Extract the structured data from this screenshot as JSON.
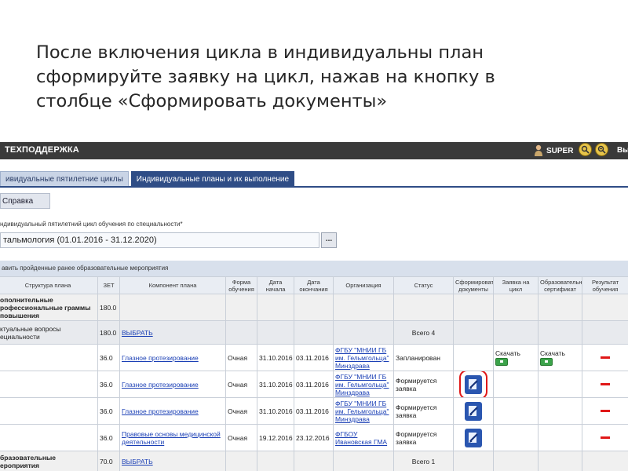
{
  "slide": {
    "title_lines": [
      "После включения цикла в индивидуальны план",
      "сформируйте заявку на цикл, нажав на кнопку в",
      "столбце «Сформировать документы»"
    ]
  },
  "app": {
    "brand": "ТЕХПОДДЕРЖКА",
    "user": "SUPER",
    "exit_label": "Вы",
    "tabs": [
      {
        "label": "ивидуальные пятилетние циклы",
        "active": false
      },
      {
        "label": "Индивидуальные планы и их выполнение",
        "active": true
      }
    ],
    "help_label": "Справка",
    "cycle_field_label": "ндивидуальный пятилетний цикл обучения по специальности*",
    "cycle_value": "тальмология (01.01.2016 - 31.12.2020)",
    "cycle_button": "...",
    "section_header": "авить пройденные ранее образовательные мероприятия",
    "table": {
      "headers": [
        "Структура плана",
        "ЗЕТ",
        "Компонент плана",
        "Форма обучения",
        "Дата начала",
        "Дата окончания",
        "Организация",
        "Статус",
        "Сформировать документы",
        "Заявка на цикл",
        "Образовательный сертификат",
        "Результат обучения"
      ],
      "group1": {
        "name": "ополнительные рофессиональные граммы повышения",
        "zet": "180.0"
      },
      "sub1": {
        "name": "ктуальные вопросы ециальности",
        "zet": "180.0",
        "link": "ВЫБРАТЬ",
        "total": "Всего 4"
      },
      "rows": [
        {
          "zet": "36.0",
          "component": "Глазное протезирование",
          "form": "Очная",
          "start": "31.10.2016",
          "end": "03.11.2016",
          "org": "ФГБУ \"МНИИ ГБ им. Гельмгольца\" Минздрава",
          "status": "Запланирован",
          "application": "Скачать",
          "certificate": "Скачать"
        },
        {
          "zet": "36.0",
          "component": "Глазное протезирование",
          "form": "Очная",
          "start": "31.10.2016",
          "end": "03.11.2016",
          "org": "ФГБУ \"МНИИ ГБ им. Гельмгольца\" Минздрава",
          "status": "Формируется заявка"
        },
        {
          "zet": "36.0",
          "component": "Глазное протезирование",
          "form": "Очная",
          "start": "31.10.2016",
          "end": "03.11.2016",
          "org": "ФГБУ \"МНИИ ГБ им. Гельмгольца\" Минздрава",
          "status": "Формируется заявка"
        },
        {
          "zet": "36.0",
          "component": "Правовые основы медицинской деятельности",
          "form": "Очная",
          "start": "19.12.2016",
          "end": "23.12.2016",
          "org": "ФГБОУ Ивановская ГМА",
          "status": "Формируется заявка"
        }
      ],
      "group2": {
        "name": "бразовательные ероприятия",
        "zet": "70.0",
        "link": "ВЫБРАТЬ",
        "total": "Всего 1"
      }
    }
  },
  "icons": {
    "user": "user-icon",
    "search": "search-icon",
    "zoom_out": "zoom-out-icon",
    "document_edit": "document-edit-icon",
    "add": "plus-icon",
    "remove": "minus-icon"
  },
  "colors": {
    "accent": "#2f4d86",
    "highlight": "#e01818",
    "link": "#1a3fb5"
  }
}
